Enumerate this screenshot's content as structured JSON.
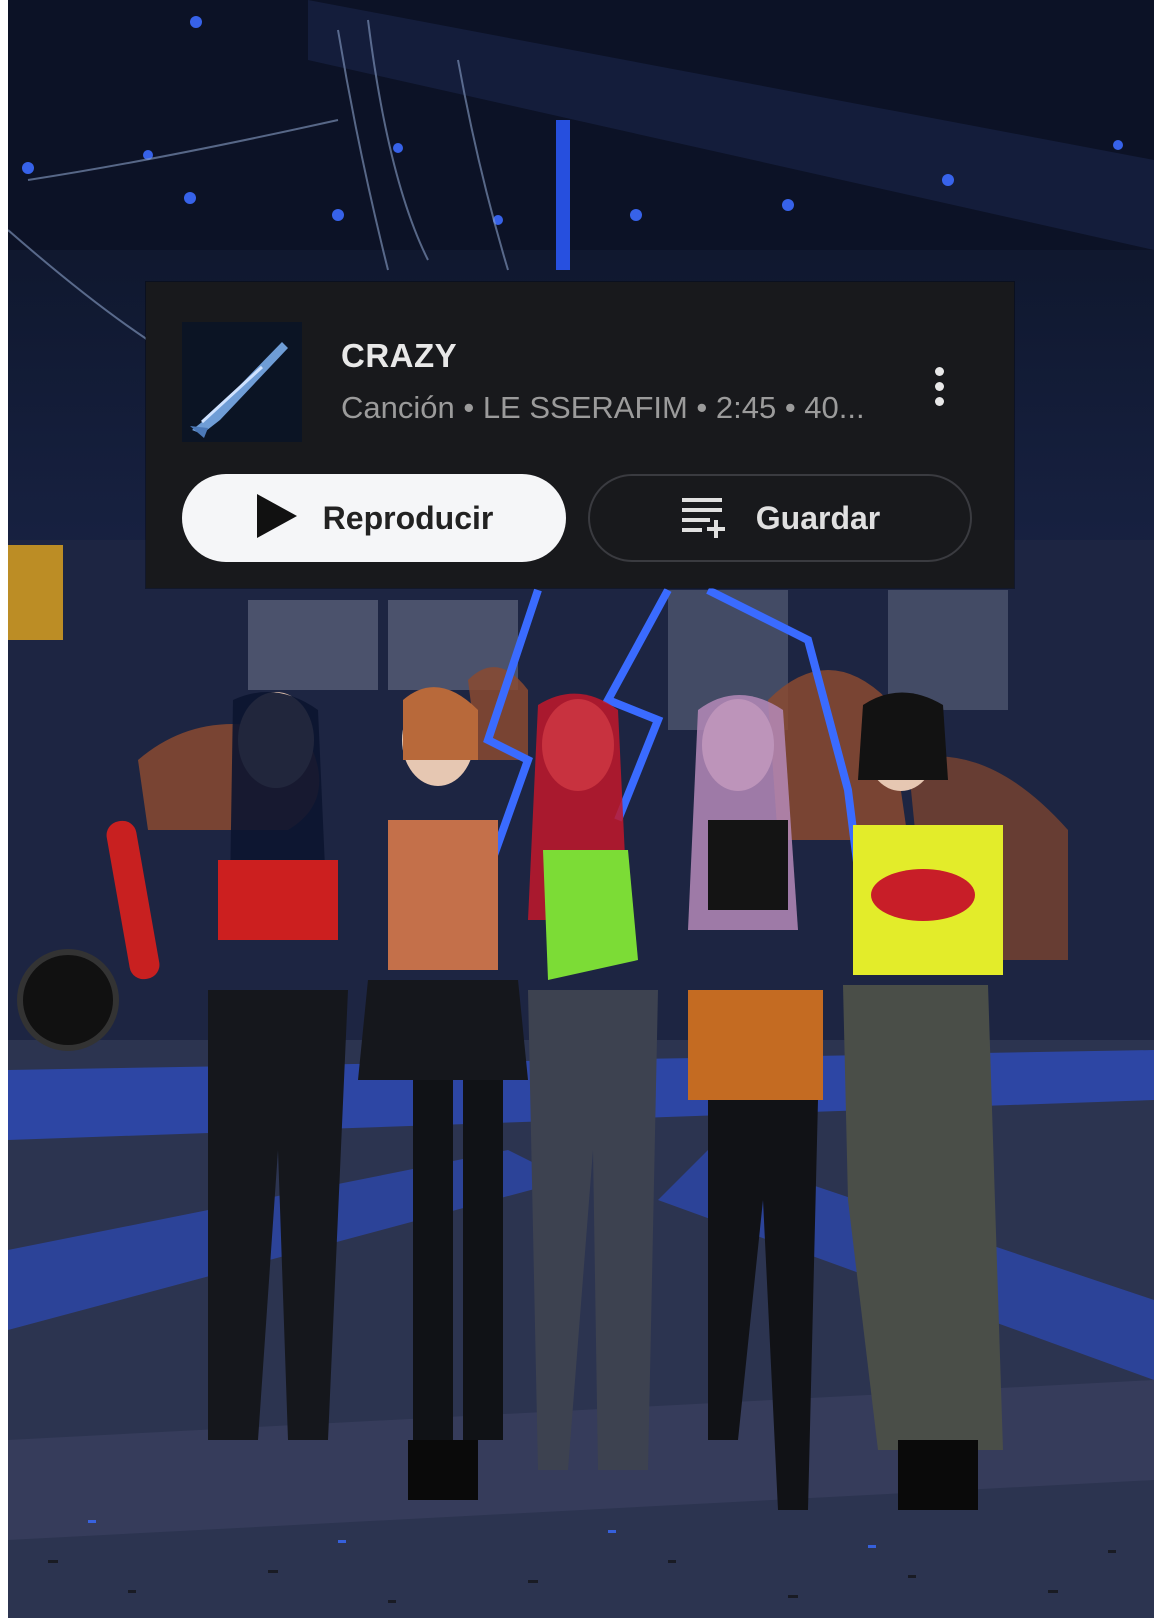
{
  "song": {
    "title": "CRAZY",
    "subtitle": "Canción • LE SSERAFIM • 2:45 • 40..."
  },
  "actions": {
    "play_label": "Reproducir",
    "save_label": "Guardar"
  },
  "icons": {
    "play": "play-icon",
    "save": "playlist-add-icon",
    "menu": "more-vert-icon"
  },
  "colors": {
    "card_bg": "#18191c",
    "play_button_bg": "#f5f6f8",
    "title_text": "#e8e8e8",
    "subtitle_text": "#9b9b9b"
  }
}
